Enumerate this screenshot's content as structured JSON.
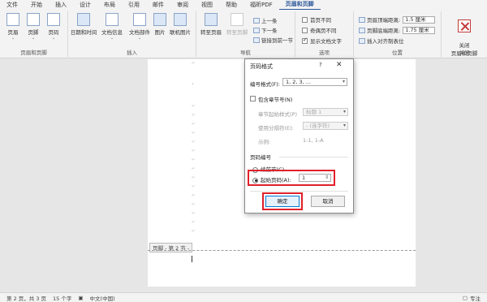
{
  "menu": [
    "文件",
    "开始",
    "插入",
    "设计",
    "布局",
    "引用",
    "邮件",
    "审阅",
    "视图",
    "帮助",
    "福昕PDF",
    "页眉和页脚"
  ],
  "ribbon": {
    "groups": {
      "header_footer": "页眉和页脚",
      "insert": "插入",
      "nav": "导航",
      "options": "选项",
      "position": "位置",
      "close": "关闭"
    },
    "header": "页眉",
    "footer": "页脚",
    "pagenum": "页码",
    "datetime": "日期和时间",
    "docinfo": "文档信息",
    "docparts": "文档部件",
    "picture": "图片",
    "online_picture": "联机图片",
    "goto_header": "转至页眉",
    "goto_footer": "转至页脚",
    "prev": "上一条",
    "next": "下一条",
    "link_prev": "链接到前一节",
    "opt_first": "首页不同",
    "opt_oddeven": "奇偶页不同",
    "opt_showtext": "显示文档文字",
    "header_top": "页眉顶端距离:",
    "header_top_val": "1.5 厘米",
    "footer_bottom": "页脚底端距离:",
    "footer_bottom_val": "1.75 厘米",
    "insert_align_tab": "插入对齐制表位",
    "close_btn": "关闭\n页眉和页脚",
    "dropdown": "⌄"
  },
  "document": {
    "footer_tag": "页脚 - 第 2 节 -"
  },
  "dialog": {
    "title": "页码格式",
    "help": "?",
    "close": "✕",
    "format_label": "编号格式(F):",
    "format_value": "1, 2, 3, ...",
    "include_chapter": "包含章节号(N)",
    "chapter_style_label": "章节起始样式(P)",
    "chapter_style_value": "标题 1",
    "separator_label": "使用分隔符(E):",
    "separator_value": "-  (连字符)",
    "example_label": "示例:",
    "example_value": "1-1, 1-A",
    "numbering_section": "页码编号",
    "continue_label": "续前节(C)",
    "start_label": "起始页码(A):",
    "start_value": "1",
    "ok": "确定",
    "cancel": "取消"
  },
  "status": {
    "page": "第 2 页，共 3 页",
    "words": "15 个字",
    "lang": "中文(中国)",
    "focus": "专注"
  }
}
